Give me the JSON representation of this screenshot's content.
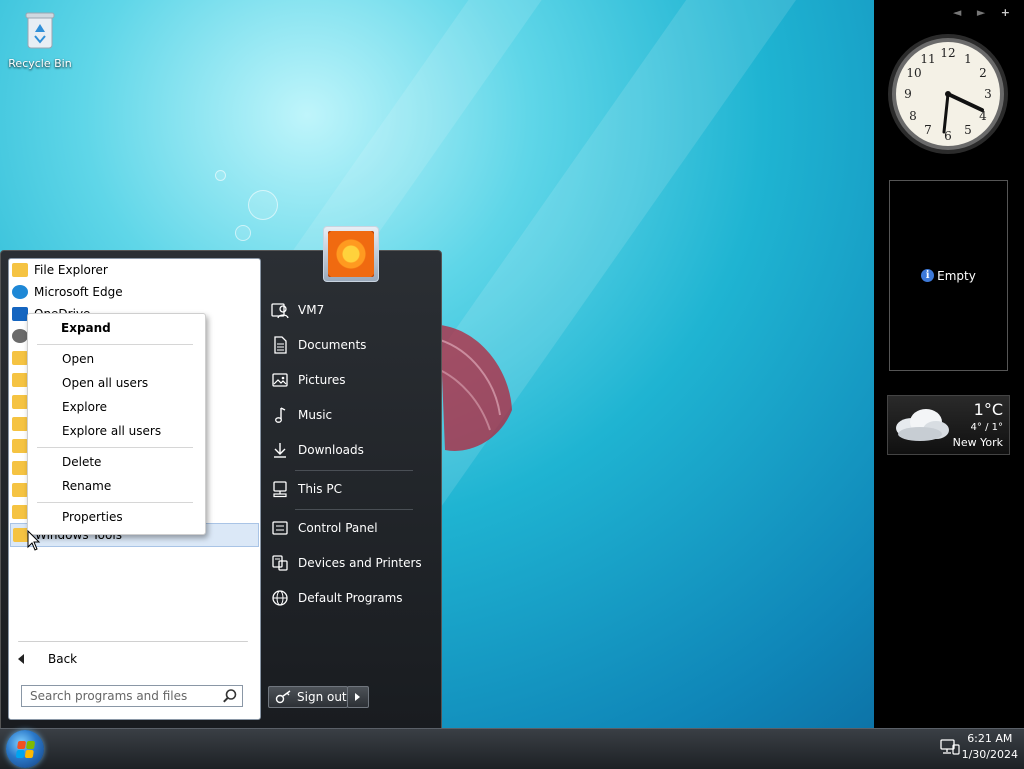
{
  "desktop": {
    "recycle_bin_label": "Recycle Bin"
  },
  "start_menu": {
    "programs": [
      {
        "label": "File Explorer",
        "icon": "folder-icon"
      },
      {
        "label": "Microsoft Edge",
        "icon": "edge-icon"
      },
      {
        "label": "OneDrive",
        "icon": "onedrive-icon"
      },
      {
        "label": "",
        "icon": "settings-icon"
      },
      {
        "label": "",
        "icon": "folder-icon"
      },
      {
        "label": "",
        "icon": "folder-icon"
      },
      {
        "label": "",
        "icon": "folder-icon"
      },
      {
        "label": "",
        "icon": "calculator-folder-icon"
      },
      {
        "label": "",
        "icon": "folder-icon"
      },
      {
        "label": "",
        "icon": "folder-icon"
      },
      {
        "label": "",
        "icon": "folder-icon"
      },
      {
        "label": "",
        "icon": "folder-icon"
      },
      {
        "label": "Windows Tools",
        "icon": "folder-icon"
      }
    ],
    "back_label": "Back",
    "search_placeholder": "Search programs and files",
    "right_items": {
      "user": "VM7",
      "documents": "Documents",
      "pictures": "Pictures",
      "music": "Music",
      "downloads": "Downloads",
      "this_pc": "This PC",
      "control_panel": "Control Panel",
      "devices": "Devices and Printers",
      "default_programs": "Default Programs"
    },
    "sign_out_label": "Sign out"
  },
  "context_menu": {
    "expand": "Expand",
    "open": "Open",
    "open_all_users": "Open all users",
    "explore": "Explore",
    "explore_all_users": "Explore all users",
    "delete": "Delete",
    "rename": "Rename",
    "properties": "Properties"
  },
  "gadgets": {
    "clock": {
      "hour": 4,
      "minute": 21
    },
    "slideshow_label": "Empty",
    "weather": {
      "temperature": "1°C",
      "range": "4° / 1°",
      "city": "New York"
    },
    "controls": [
      "◄",
      "►",
      "+"
    ]
  },
  "taskbar": {
    "time": "6:21 AM",
    "date": "1/30/2024"
  },
  "colors": {
    "menu_dark": "#1d2125",
    "selection": "#dbe8f7",
    "folder": "#f5c342",
    "desktop_cyan": "#1fb4d2"
  }
}
